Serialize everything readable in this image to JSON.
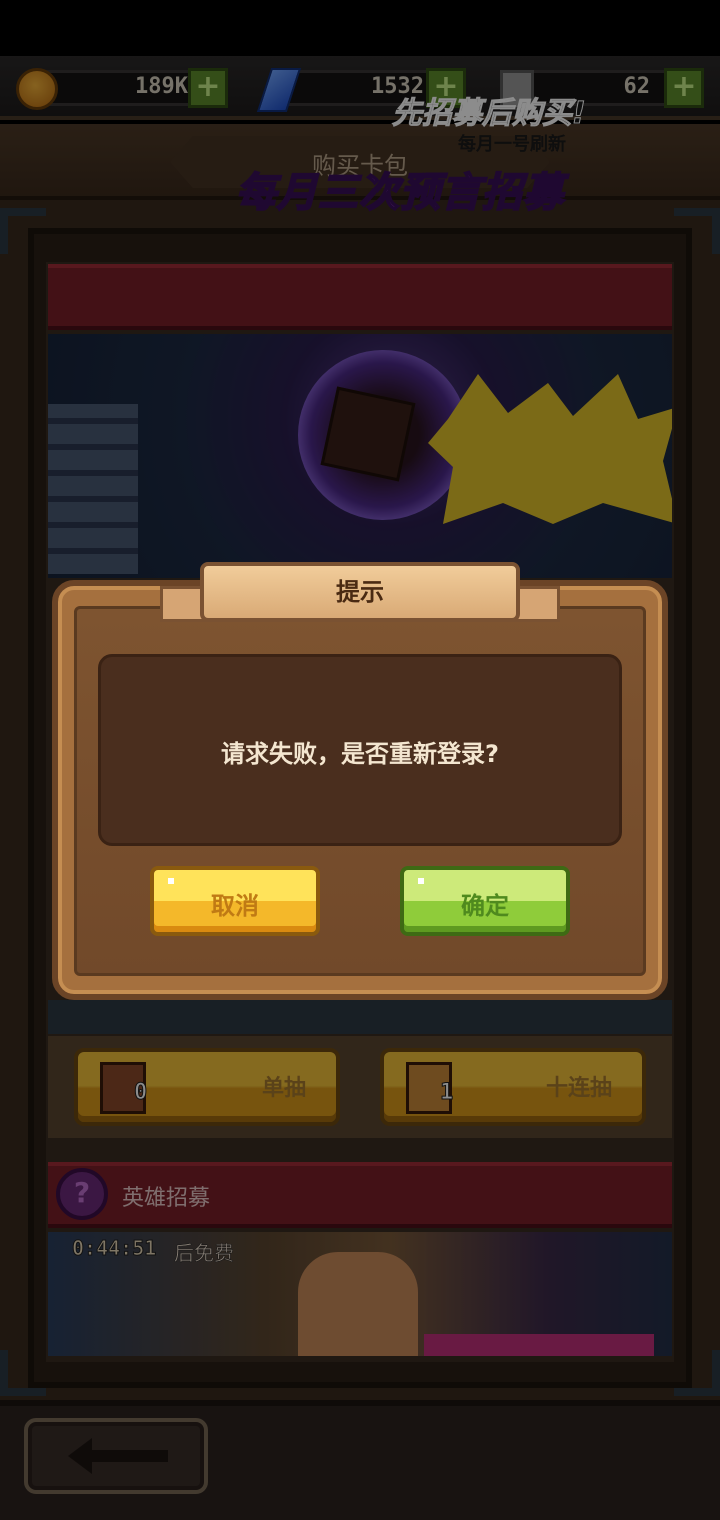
{
  "currencies": {
    "gold": {
      "value": "189K"
    },
    "gems": {
      "value": "1532"
    },
    "potions": {
      "value": "62"
    }
  },
  "header": {
    "title": "购买卡包"
  },
  "banner": {
    "burst_text": "先招募后购买!",
    "burst_subtext": "每月一号刷新",
    "main_text": "每月三次预言招募"
  },
  "draw": {
    "single": {
      "label": "单抽",
      "count": "0"
    },
    "ten": {
      "label": "十连抽",
      "count": "1"
    }
  },
  "hero_recruit": {
    "title": "英雄招募",
    "timer": "0:44:51",
    "free_suffix": "后免费"
  },
  "dialog": {
    "title": "提示",
    "message": "请求失败，是否重新登录?",
    "cancel_label": "取消",
    "confirm_label": "确定"
  }
}
